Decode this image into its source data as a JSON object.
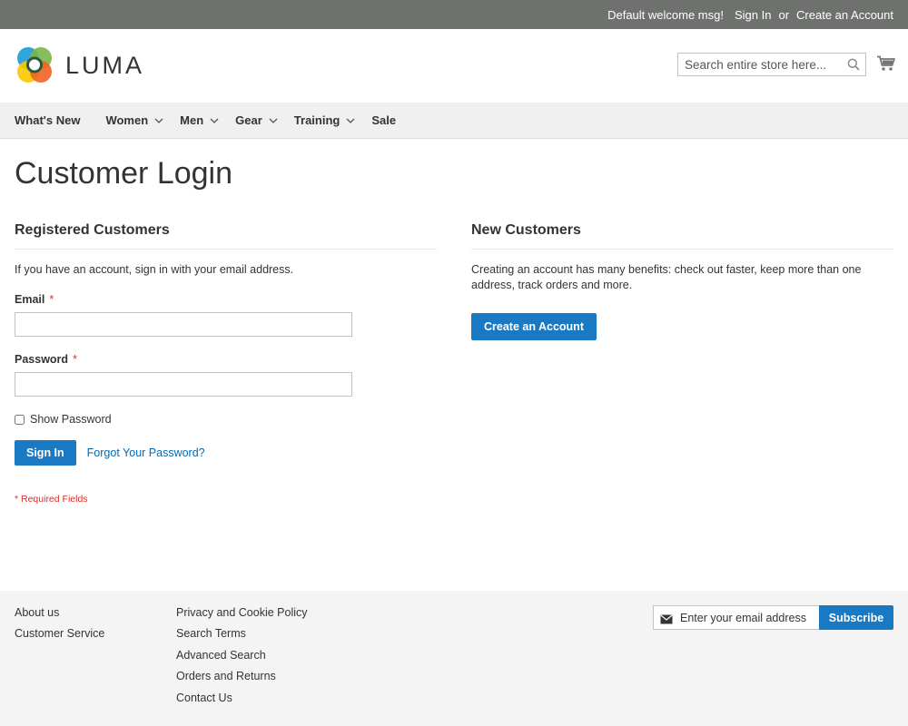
{
  "topbar": {
    "welcome": "Default welcome msg!",
    "sign_in": "Sign In",
    "or": "or",
    "create_account": "Create an Account"
  },
  "header": {
    "logo_text": "LUMA",
    "search_placeholder": "Search entire store here...",
    "search_icon": "magnifier-icon",
    "cart_icon": "shopping-cart-icon"
  },
  "nav": {
    "items": [
      {
        "label": "What's New",
        "has_dropdown": false
      },
      {
        "label": "Women",
        "has_dropdown": true
      },
      {
        "label": "Men",
        "has_dropdown": true
      },
      {
        "label": "Gear",
        "has_dropdown": true
      },
      {
        "label": "Training",
        "has_dropdown": true
      },
      {
        "label": "Sale",
        "has_dropdown": false
      }
    ]
  },
  "main": {
    "page_title": "Customer Login",
    "registered": {
      "title": "Registered Customers",
      "intro": "If you have an account, sign in with your email address.",
      "email_label": "Email",
      "email_value": "",
      "password_label": "Password",
      "password_value": "",
      "required_mark": "*",
      "show_password_label": "Show Password",
      "show_password_checked": false,
      "sign_in_button": "Sign In",
      "forgot_link": "Forgot Your Password?",
      "required_note": "* Required Fields"
    },
    "new_customers": {
      "title": "New Customers",
      "text": "Creating an account has many benefits: check out faster, keep more than one address, track orders and more.",
      "create_button": "Create an Account"
    }
  },
  "footer": {
    "col1": [
      "About us",
      "Customer Service"
    ],
    "col2": [
      "Privacy and Cookie Policy",
      "Search Terms",
      "Advanced Search",
      "Orders and Returns",
      "Contact Us"
    ],
    "newsletter_placeholder": "Enter your email address",
    "newsletter_icon": "envelope-icon",
    "subscribe_button": "Subscribe"
  },
  "colors": {
    "topbar_bg": "#6e716e",
    "primary_button": "#1979c3",
    "link": "#006bb4",
    "required": "#e02b27",
    "nav_bg": "#f0f0f0",
    "footer_bg": "#f4f4f4"
  }
}
